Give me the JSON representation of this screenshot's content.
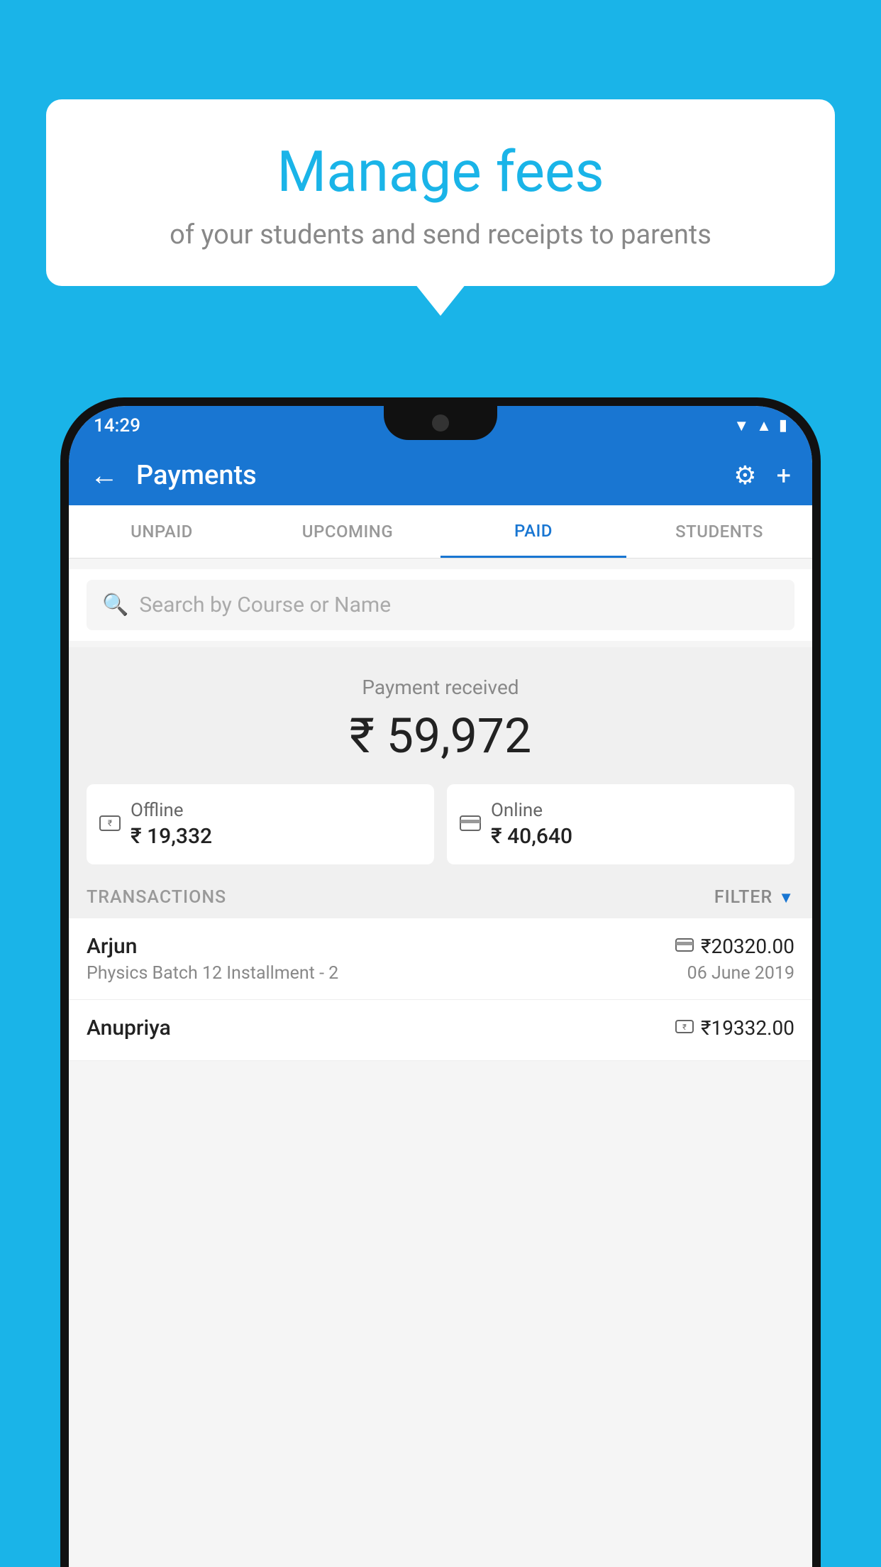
{
  "page": {
    "background_color": "#1ab4e8"
  },
  "speech_bubble": {
    "title": "Manage fees",
    "subtitle": "of your students and send receipts to parents"
  },
  "status_bar": {
    "time": "14:29",
    "icons": [
      "wifi",
      "signal",
      "battery"
    ]
  },
  "top_bar": {
    "back_label": "←",
    "title": "Payments",
    "gear_icon": "⚙",
    "plus_icon": "+"
  },
  "tabs": [
    {
      "label": "UNPAID",
      "active": false
    },
    {
      "label": "UPCOMING",
      "active": false
    },
    {
      "label": "PAID",
      "active": true
    },
    {
      "label": "STUDENTS",
      "active": false
    }
  ],
  "search": {
    "placeholder": "Search by Course or Name"
  },
  "payment_summary": {
    "label": "Payment received",
    "total": "₹ 59,972",
    "offline": {
      "icon": "rupee-card",
      "type": "Offline",
      "amount": "₹ 19,332"
    },
    "online": {
      "icon": "credit-card",
      "type": "Online",
      "amount": "₹ 40,640"
    }
  },
  "transactions_section": {
    "label": "TRANSACTIONS",
    "filter_label": "FILTER"
  },
  "transactions": [
    {
      "name": "Arjun",
      "payment_icon": "card",
      "amount": "₹20320.00",
      "course": "Physics Batch 12 Installment - 2",
      "date": "06 June 2019"
    },
    {
      "name": "Anupriya",
      "payment_icon": "rupee",
      "amount": "₹19332.00",
      "course": "",
      "date": ""
    }
  ]
}
